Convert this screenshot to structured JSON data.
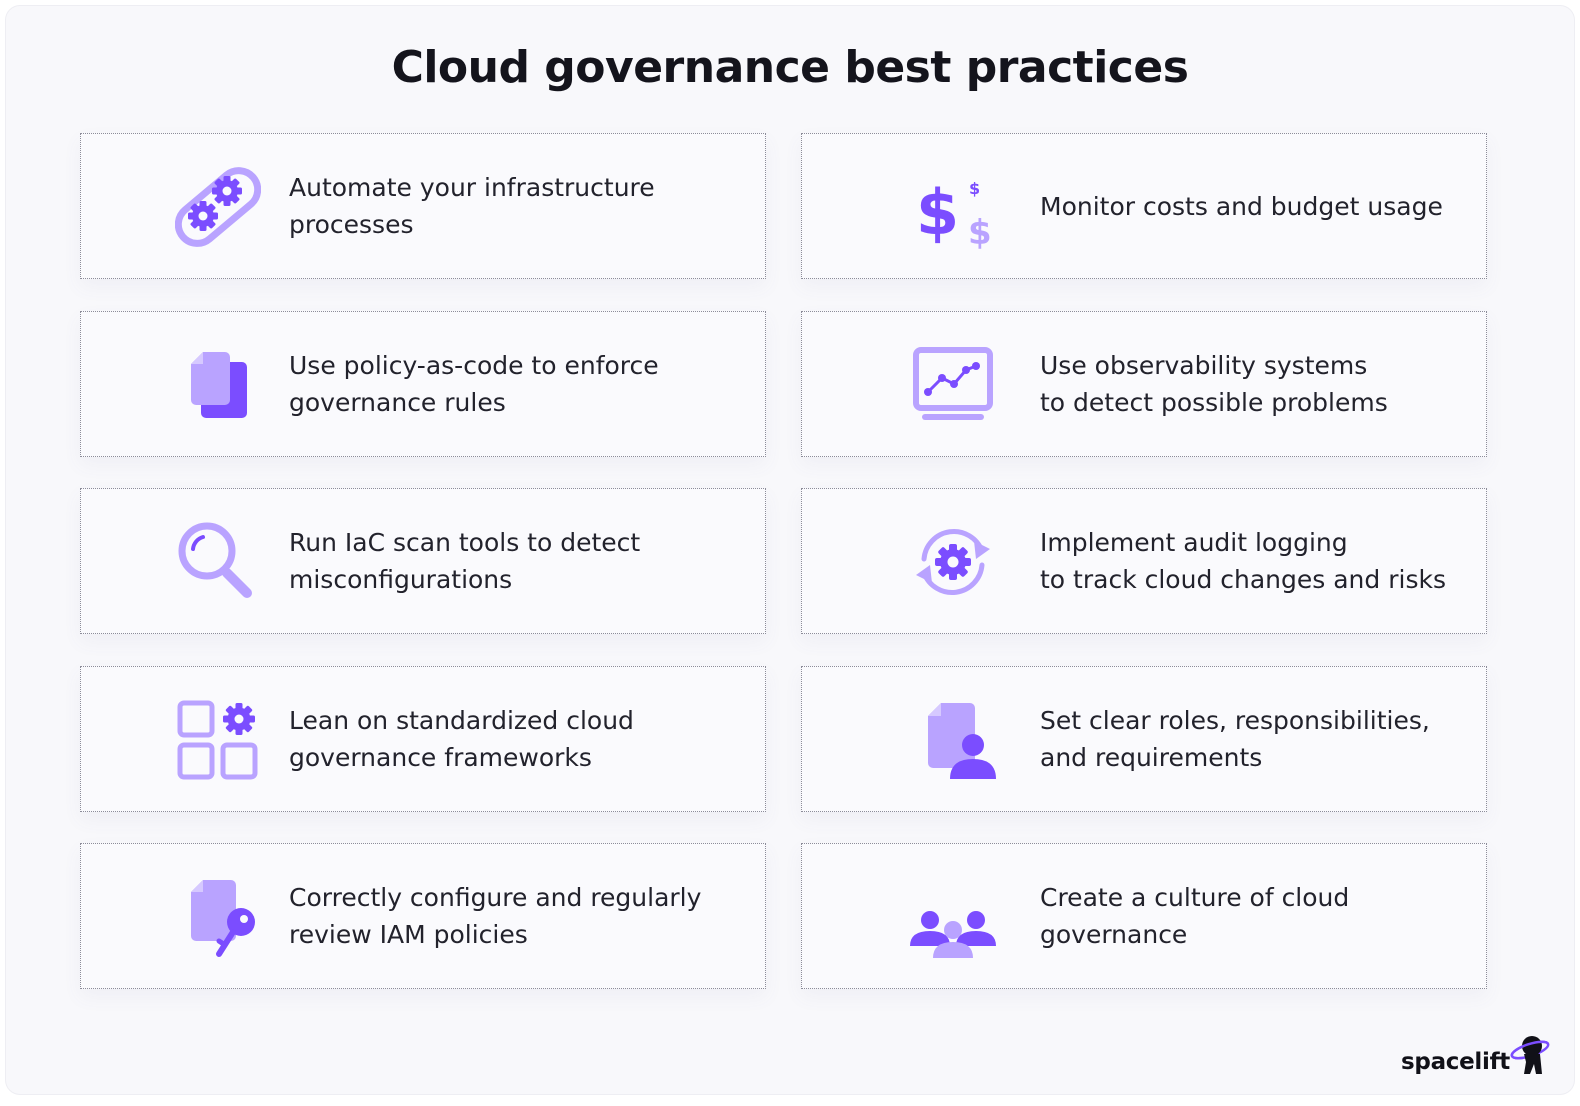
{
  "title": "Cloud governance best practices",
  "colors": {
    "primary": "#7b4dff",
    "light": "#b9a3ff",
    "dark": "#6a3cf2"
  },
  "cards": [
    {
      "icon": "gears-icon",
      "label": "Automate your infrastructure\nprocesses"
    },
    {
      "icon": "dollar-icon",
      "label": "Monitor costs and budget usage"
    },
    {
      "icon": "documents-icon",
      "label": "Use policy-as-code to enforce\ngovernance rules"
    },
    {
      "icon": "monitor-chart-icon",
      "label": "Use observability systems\nto detect possible problems"
    },
    {
      "icon": "magnifier-icon",
      "label": "Run IaC scan tools to detect\nmisconfigurations"
    },
    {
      "icon": "sync-gear-icon",
      "label": "Implement audit logging\nto track cloud changes and risks"
    },
    {
      "icon": "grid-gear-icon",
      "label": "Lean on standardized cloud\ngovernance frameworks"
    },
    {
      "icon": "document-user-icon",
      "label": "Set clear roles, responsibilities,\nand requirements"
    },
    {
      "icon": "document-key-icon",
      "label": "Correctly configure and regularly\nreview IAM policies"
    },
    {
      "icon": "team-icon",
      "label": "Create a culture of cloud\ngovernance"
    }
  ],
  "brand": {
    "name": "spacelift",
    "icon": "astronaut-logo-icon"
  }
}
